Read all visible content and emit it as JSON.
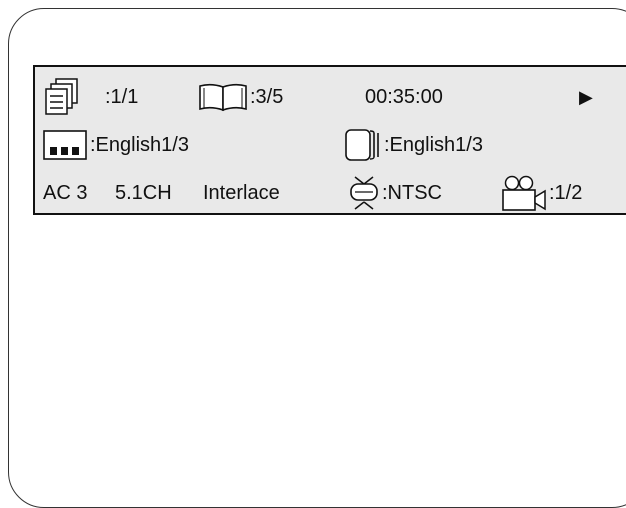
{
  "osd": {
    "title_chapter": {
      "icon": "title-stack-icon",
      "value": ":1/1"
    },
    "chapter": {
      "icon": "open-book-icon",
      "value": ":3/5"
    },
    "elapsed_time": "00:35:00",
    "play_state": {
      "icon": "play-icon",
      "glyph": "▶"
    },
    "audio": {
      "icon": "audio-bars-icon",
      "value": ":English1/3"
    },
    "subtitle": {
      "icon": "subtitle-icon",
      "value": ":English1/3"
    },
    "audio_format": "AC 3",
    "channels": "5.1CH",
    "scan_mode": "Interlace",
    "tv_system": {
      "icon": "tv-icon",
      "value": ":NTSC"
    },
    "angle": {
      "icon": "camera-icon",
      "value": ":1/2"
    }
  }
}
